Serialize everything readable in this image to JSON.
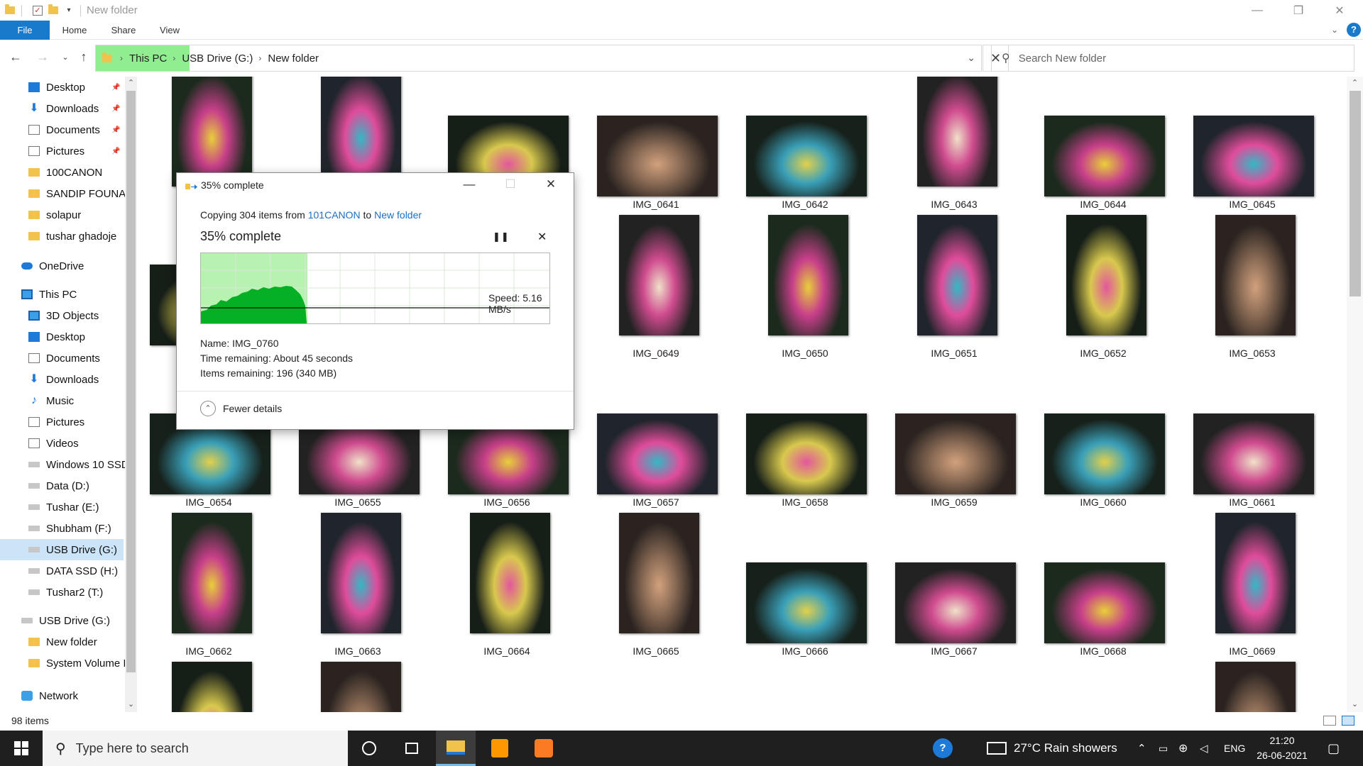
{
  "window": {
    "title": "New folder",
    "controls": {
      "minimize": "—",
      "restore": "❐",
      "close": "✕"
    }
  },
  "ribbon": {
    "tabs": [
      "File",
      "Home",
      "Share",
      "View"
    ],
    "help": "?"
  },
  "address": {
    "segments": [
      "This PC",
      "USB Drive (G:)",
      "New folder"
    ],
    "highlight_color": "#90ee90"
  },
  "search": {
    "placeholder": "Search New folder"
  },
  "nav": {
    "items": [
      {
        "label": "Desktop",
        "icon": "desktop-icon",
        "pinned": true
      },
      {
        "label": "Downloads",
        "icon": "download-icon",
        "pinned": true
      },
      {
        "label": "Documents",
        "icon": "documents-icon",
        "pinned": true
      },
      {
        "label": "Pictures",
        "icon": "pictures-icon",
        "pinned": true
      },
      {
        "label": "100CANON",
        "icon": "folder-icon"
      },
      {
        "label": "SANDIP FOUNAI",
        "icon": "folder-icon"
      },
      {
        "label": "solapur",
        "icon": "folder-icon"
      },
      {
        "label": "tushar ghadoje",
        "icon": "folder-icon"
      },
      {
        "label": "OneDrive",
        "icon": "onedrive-icon"
      },
      {
        "label": "This PC",
        "icon": "this-pc-icon"
      },
      {
        "label": "3D Objects",
        "icon": "3d-objects-icon"
      },
      {
        "label": "Desktop",
        "icon": "desktop-icon"
      },
      {
        "label": "Documents",
        "icon": "documents-icon"
      },
      {
        "label": "Downloads",
        "icon": "download-icon"
      },
      {
        "label": "Music",
        "icon": "music-icon"
      },
      {
        "label": "Pictures",
        "icon": "pictures-icon"
      },
      {
        "label": "Videos",
        "icon": "videos-icon"
      },
      {
        "label": "Windows 10 SSD",
        "icon": "drive-icon"
      },
      {
        "label": "Data (D:)",
        "icon": "drive-icon"
      },
      {
        "label": "Tushar (E:)",
        "icon": "drive-icon"
      },
      {
        "label": "Shubham (F:)",
        "icon": "drive-icon"
      },
      {
        "label": "USB Drive (G:)",
        "icon": "usb-drive-icon",
        "selected": true
      },
      {
        "label": "DATA SSD (H:)",
        "icon": "drive-icon"
      },
      {
        "label": "Tushar2 (T:)",
        "icon": "drive-icon"
      },
      {
        "label": "USB Drive (G:)",
        "icon": "usb-drive-icon"
      },
      {
        "label": "New folder",
        "icon": "folder-icon"
      },
      {
        "label": "System Volume I",
        "icon": "folder-icon"
      },
      {
        "label": "Network",
        "icon": "network-icon"
      }
    ]
  },
  "files": [
    {
      "name": "",
      "orient": "port"
    },
    {
      "name": "",
      "orient": "port"
    },
    {
      "name": "",
      "orient": "land"
    },
    {
      "name": "IMG_0641",
      "orient": "land"
    },
    {
      "name": "IMG_0642",
      "orient": "land"
    },
    {
      "name": "IMG_0643",
      "orient": "port"
    },
    {
      "name": "IMG_0644",
      "orient": "land"
    },
    {
      "name": "IMG_0645",
      "orient": "land"
    },
    {
      "name": "",
      "orient": "land"
    },
    {
      "name": "",
      "orient": "port"
    },
    {
      "name": "",
      "orient": "port"
    },
    {
      "name": "IMG_0649",
      "orient": "port"
    },
    {
      "name": "IMG_0650",
      "orient": "port"
    },
    {
      "name": "IMG_0651",
      "orient": "port"
    },
    {
      "name": "IMG_0652",
      "orient": "port"
    },
    {
      "name": "IMG_0653",
      "orient": "port"
    },
    {
      "name": "IMG_0654",
      "orient": "land"
    },
    {
      "name": "IMG_0655",
      "orient": "land"
    },
    {
      "name": "IMG_0656",
      "orient": "land"
    },
    {
      "name": "IMG_0657",
      "orient": "land"
    },
    {
      "name": "IMG_0658",
      "orient": "land"
    },
    {
      "name": "IMG_0659",
      "orient": "land"
    },
    {
      "name": "IMG_0660",
      "orient": "land"
    },
    {
      "name": "IMG_0661",
      "orient": "land"
    },
    {
      "name": "IMG_0662",
      "orient": "port"
    },
    {
      "name": "IMG_0663",
      "orient": "port"
    },
    {
      "name": "IMG_0664",
      "orient": "port"
    },
    {
      "name": "IMG_0665",
      "orient": "port"
    },
    {
      "name": "IMG_0666",
      "orient": "land"
    },
    {
      "name": "IMG_0667",
      "orient": "land"
    },
    {
      "name": "IMG_0668",
      "orient": "land"
    },
    {
      "name": "IMG_0669",
      "orient": "port"
    },
    {
      "name": "",
      "orient": "port"
    },
    {
      "name": "",
      "orient": "port"
    },
    {
      "name": "",
      "orient": "none"
    },
    {
      "name": "",
      "orient": "none"
    },
    {
      "name": "",
      "orient": "none"
    },
    {
      "name": "",
      "orient": "none"
    },
    {
      "name": "",
      "orient": "none"
    },
    {
      "name": "",
      "orient": "port"
    }
  ],
  "status": {
    "item_count": "98 items"
  },
  "copy_dialog": {
    "title": "35% complete",
    "copying_prefix": "Copying 304 items from ",
    "source": "101CANON",
    "to_word": " to ",
    "destination": "New folder",
    "percent_text": "35% complete",
    "progress_fraction": 0.35,
    "speed": "Speed: 5.16 MB/s",
    "name_line": "Name: IMG_0760",
    "time_line": "Time remaining: About 45 seconds",
    "items_line": "Items remaining: 196 (340 MB)",
    "fewer_details": "Fewer details",
    "pause_glyph": "❚❚",
    "cancel_glyph": "✕"
  },
  "taskbar": {
    "search_placeholder": "Type here to search",
    "weather": "27°C  Rain showers",
    "language": "ENG",
    "time": "21:20",
    "date": "26-06-2021"
  },
  "colors": {
    "accent": "#1979ca",
    "selection": "#cce4f7",
    "progress_fill": "#06b025",
    "progress_area": "#b7f2b0",
    "taskbar": "#1f1f1f"
  }
}
